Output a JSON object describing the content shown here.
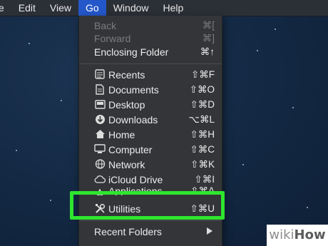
{
  "menubar": {
    "items": [
      "e",
      "Edit",
      "View",
      "Go",
      "Window",
      "Help"
    ],
    "active": "Go"
  },
  "go_menu": {
    "back": {
      "label": "Back",
      "shortcut": "⌘["
    },
    "forward": {
      "label": "Forward",
      "shortcut": "⌘]"
    },
    "enclosing": {
      "label": "Enclosing Folder",
      "shortcut": "⌘↑"
    },
    "items": [
      {
        "label": "Recents",
        "shortcut": "⇧⌘F",
        "icon": "recents-icon"
      },
      {
        "label": "Documents",
        "shortcut": "⇧⌘O",
        "icon": "documents-icon"
      },
      {
        "label": "Desktop",
        "shortcut": "⇧⌘D",
        "icon": "desktop-icon"
      },
      {
        "label": "Downloads",
        "shortcut": "⌥⌘L",
        "icon": "downloads-icon"
      },
      {
        "label": "Home",
        "shortcut": "⇧⌘H",
        "icon": "home-icon"
      },
      {
        "label": "Computer",
        "shortcut": "⇧⌘C",
        "icon": "computer-icon"
      },
      {
        "label": "Network",
        "shortcut": "⇧⌘K",
        "icon": "network-icon"
      },
      {
        "label": "iCloud Drive",
        "shortcut": "⇧⌘I",
        "icon": "icloud-icon"
      },
      {
        "label": "Applications",
        "shortcut": "⇧⌘A",
        "icon": "applications-icon"
      },
      {
        "label": "Utilities",
        "shortcut": "⇧⌘U",
        "icon": "utilities-icon"
      }
    ],
    "recent_folders": {
      "label": "Recent Folders"
    }
  },
  "highlight_color": "#2ee62e",
  "watermark": {
    "prefix": "wiki",
    "suffix": "How"
  }
}
